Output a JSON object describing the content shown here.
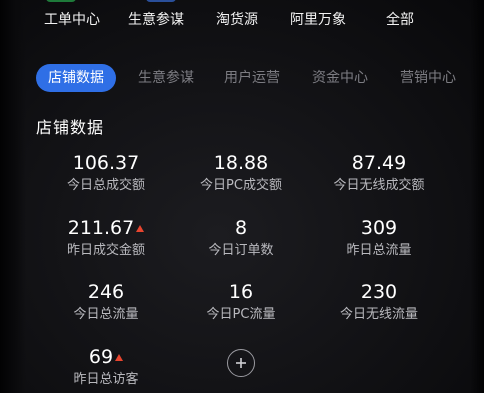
{
  "top_nav": {
    "items": [
      "工单中心",
      "生意参谋",
      "淘货源",
      "阿里万象",
      "全部"
    ]
  },
  "tabs": [
    "店铺数据",
    "生意参谋",
    "用户运营",
    "资金中心",
    "营销中心"
  ],
  "section": {
    "title": "店铺数据"
  },
  "metrics": [
    {
      "value": "106.37",
      "label": "今日总成交额",
      "trend": ""
    },
    {
      "value": "18.88",
      "label": "今日PC成交额",
      "trend": ""
    },
    {
      "value": "87.49",
      "label": "今日无线成交额",
      "trend": ""
    },
    {
      "value": "211.67",
      "label": "昨日成交金额",
      "trend": "up"
    },
    {
      "value": "8",
      "label": "今日订单数",
      "trend": ""
    },
    {
      "value": "309",
      "label": "昨日总流量",
      "trend": ""
    },
    {
      "value": "246",
      "label": "今日总流量",
      "trend": ""
    },
    {
      "value": "16",
      "label": "今日PC流量",
      "trend": ""
    },
    {
      "value": "230",
      "label": "今日无线流量",
      "trend": ""
    },
    {
      "value": "69",
      "label": "昨日总访客",
      "trend": "up"
    }
  ],
  "colors": {
    "accent": "#2f6fe6",
    "trend_up": "#e8452f",
    "background": "#111114"
  },
  "icons": {
    "add": "plus-icon",
    "trend": "up-arrow-icon"
  }
}
